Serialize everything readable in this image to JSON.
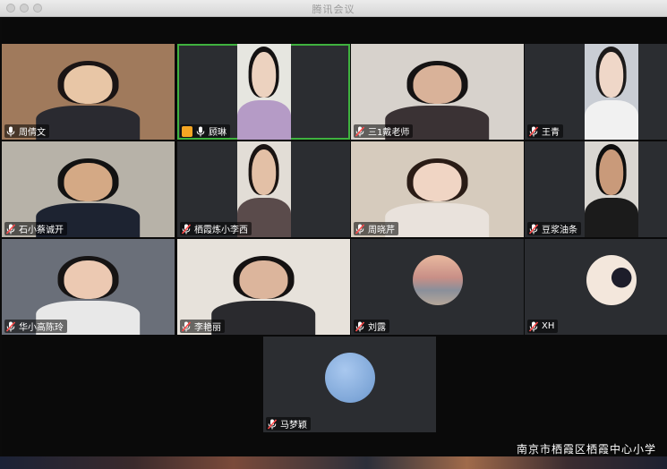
{
  "window": {
    "title": "腾讯会议"
  },
  "watermark": "南京市栖霞区栖霞中心小学",
  "participants": [
    {
      "name": "周倩文",
      "mic": "on",
      "active": false,
      "kind": "video",
      "bg": "#a07a5c",
      "skin": "#e8c6a6",
      "hair": "#1a1414",
      "cloth": "#2a2a30"
    },
    {
      "name": "顾琳",
      "mic": "on",
      "active": true,
      "sharing": true,
      "kind": "video",
      "bg": "#e6e6e0",
      "skin": "#ecd2bf",
      "hair": "#141212",
      "cloth": "#b59bc6"
    },
    {
      "name": "三1戴老师",
      "mic": "muted",
      "active": false,
      "kind": "video",
      "bg": "#d7d2cc",
      "skin": "#d9b299",
      "hair": "#151313",
      "cloth": "#3a3234"
    },
    {
      "name": "王青",
      "mic": "muted",
      "active": false,
      "kind": "video",
      "bg": "#c9cdd4",
      "skin": "#efd7c8",
      "hair": "#1c1a1a",
      "cloth": "#f1f1f1"
    },
    {
      "name": "石小蔡诚开",
      "mic": "muted",
      "active": false,
      "kind": "video",
      "bg": "#b7b2a8",
      "skin": "#d4a985",
      "hair": "#121212",
      "cloth": "#1d2331"
    },
    {
      "name": "栖霞炼小李西",
      "mic": "muted",
      "active": false,
      "kind": "video",
      "bg": "#e2ddd6",
      "skin": "#e3c0a6",
      "hair": "#1a1412",
      "cloth": "#5a4b4b"
    },
    {
      "name": "周晓芹",
      "mic": "muted",
      "active": false,
      "kind": "video",
      "bg": "#d6cbbd",
      "skin": "#f0d5c4",
      "hair": "#2a1c16",
      "cloth": "#e9e2dc"
    },
    {
      "name": "豆浆油条",
      "mic": "muted",
      "active": false,
      "kind": "video",
      "bg": "#d9d6d1",
      "skin": "#c99a7a",
      "hair": "#0e0e0e",
      "cloth": "#1b1b1b"
    },
    {
      "name": "华小高陈玲",
      "mic": "muted",
      "active": false,
      "kind": "video",
      "bg": "#6a6f79",
      "skin": "#ecc9b2",
      "hair": "#161414",
      "cloth": "#e8e8e8"
    },
    {
      "name": "李艳丽",
      "mic": "muted",
      "active": false,
      "kind": "video",
      "bg": "#e7e2db",
      "skin": "#dcb59c",
      "hair": "#151212",
      "cloth": "#2a2a2e"
    },
    {
      "name": "刘露",
      "mic": "muted",
      "active": false,
      "kind": "avatar",
      "avatar": "sunset"
    },
    {
      "name": "XH",
      "mic": "muted",
      "active": false,
      "kind": "avatar",
      "avatar": "portrait"
    },
    {
      "name": "马梦颖",
      "mic": "muted",
      "active": false,
      "kind": "avatar",
      "avatar": "sky"
    }
  ]
}
